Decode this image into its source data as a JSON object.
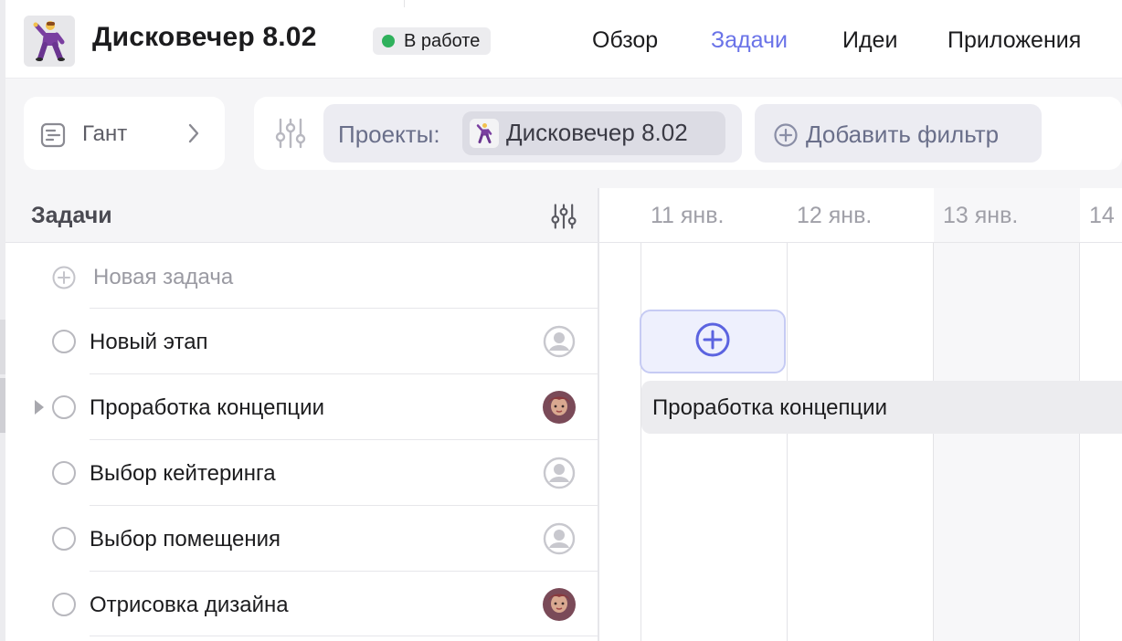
{
  "header": {
    "project_title": "Дисковечер 8.02",
    "project_icon": "dancing-man-icon",
    "status": {
      "label": "В работе",
      "color": "#2fb15c"
    },
    "nav": [
      {
        "label": "Обзор",
        "active": false
      },
      {
        "label": "Задачи",
        "active": true
      },
      {
        "label": "Идеи",
        "active": false
      },
      {
        "label": "Приложения",
        "active": false
      }
    ],
    "accent_color": "#6a73e8"
  },
  "toolbar": {
    "view_label": "Гант",
    "view_icon": "gantt-doc-icon",
    "filter_icon": "sliders-icon",
    "project_filter_label": "Проекты:",
    "project_filter_value": "Дисковечер 8.02",
    "add_filter_label": "Добавить фильтр"
  },
  "tasks": {
    "header_title": "Задачи",
    "new_task_label": "Новая задача",
    "items": [
      {
        "label": "Новый этап",
        "expandable": false,
        "assignee": "empty-avatar-icon"
      },
      {
        "label": "Проработка концепции",
        "expandable": true,
        "assignee": "user-avatar"
      },
      {
        "label": "Выбор кейтеринга",
        "expandable": false,
        "assignee": "empty-avatar-icon"
      },
      {
        "label": "Выбор помещения",
        "expandable": false,
        "assignee": "empty-avatar-icon"
      },
      {
        "label": "Отрисовка дизайна",
        "expandable": false,
        "assignee": "user-avatar"
      }
    ]
  },
  "timeline": {
    "dates": [
      "11 янв.",
      "12 янв.",
      "13 янв.",
      "14"
    ],
    "bar_label": "Проработка концепции"
  }
}
